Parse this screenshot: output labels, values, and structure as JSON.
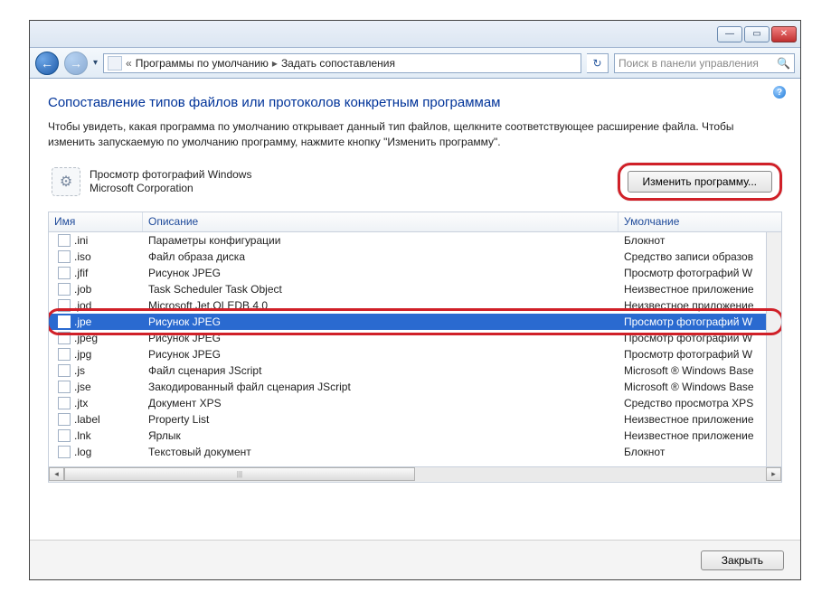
{
  "titlebar": {
    "min": "—",
    "max": "▭",
    "close": "✕"
  },
  "breadcrumb": {
    "dd": "«",
    "item1": "Программы по умолчанию",
    "item2": "Задать сопоставления",
    "sep": "▸"
  },
  "search": {
    "placeholder": "Поиск в панели управления"
  },
  "heading": "Сопоставление типов файлов или протоколов конкретным программам",
  "description": "Чтобы увидеть, какая программа по умолчанию открывает данный тип файлов, щелкните соответствующее расширение файла. Чтобы изменить запускаемую по умолчанию программу, нажмите кнопку \"Изменить программу\".",
  "program": {
    "name": "Просмотр фотографий Windows",
    "publisher": "Microsoft Corporation"
  },
  "change_button": "Изменить программу...",
  "columns": {
    "name": "Имя",
    "desc": "Описание",
    "def": "Умолчание"
  },
  "rows": [
    {
      "ext": ".ini",
      "desc": "Параметры конфигурации",
      "def": "Блокнот"
    },
    {
      "ext": ".iso",
      "desc": "Файл образа диска",
      "def": "Средство записи образов"
    },
    {
      "ext": ".jfif",
      "desc": "Рисунок JPEG",
      "def": "Просмотр фотографий W"
    },
    {
      "ext": ".job",
      "desc": "Task Scheduler Task Object",
      "def": "Неизвестное приложение"
    },
    {
      "ext": ".jod",
      "desc": "Microsoft.Jet.OLEDB.4.0",
      "def": "Неизвестное приложение"
    },
    {
      "ext": ".jpe",
      "desc": "Рисунок JPEG",
      "def": "Просмотр фотографий W",
      "selected": true
    },
    {
      "ext": ".jpeg",
      "desc": "Рисунок JPEG",
      "def": "Просмотр фотографий W"
    },
    {
      "ext": ".jpg",
      "desc": "Рисунок JPEG",
      "def": "Просмотр фотографий W"
    },
    {
      "ext": ".js",
      "desc": "Файл сценария JScript",
      "def": "Microsoft ® Windows Base"
    },
    {
      "ext": ".jse",
      "desc": "Закодированный файл сценария JScript",
      "def": "Microsoft ® Windows Base"
    },
    {
      "ext": ".jtx",
      "desc": "Документ XPS",
      "def": "Средство просмотра XPS"
    },
    {
      "ext": ".label",
      "desc": "Property List",
      "def": "Неизвестное приложение"
    },
    {
      "ext": ".lnk",
      "desc": "Ярлык",
      "def": "Неизвестное приложение"
    },
    {
      "ext": ".log",
      "desc": "Текстовый документ",
      "def": "Блокнот"
    }
  ],
  "footer": {
    "close": "Закрыть"
  }
}
